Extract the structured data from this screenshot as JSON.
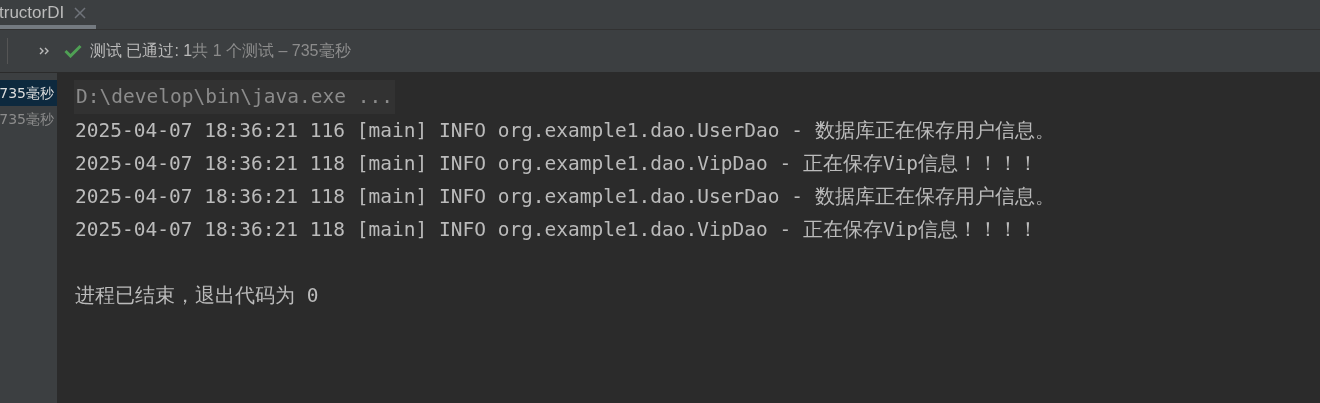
{
  "tab": {
    "label": "tructorDI",
    "selected": true
  },
  "toolbar": {
    "status": "测试 已通过: 1",
    "summary": "共 1 个测试 – 735毫秒"
  },
  "tree": [
    {
      "label": "735毫秒",
      "selected": true
    },
    {
      "label": "735毫秒",
      "selected": false
    }
  ],
  "console": {
    "command": "D:\\develop\\bin\\java.exe ...",
    "lines": [
      "2025-04-07 18:36:21 116 [main] INFO org.example1.dao.UserDao - 数据库正在保存用户信息。",
      "2025-04-07 18:36:21 118 [main] INFO org.example1.dao.VipDao - 正在保存Vip信息！！！！",
      "2025-04-07 18:36:21 118 [main] INFO org.example1.dao.UserDao - 数据库正在保存用户信息。",
      "2025-04-07 18:36:21 118 [main] INFO org.example1.dao.VipDao - 正在保存Vip信息！！！！"
    ],
    "exit": "进程已结束，退出代码为 0"
  }
}
